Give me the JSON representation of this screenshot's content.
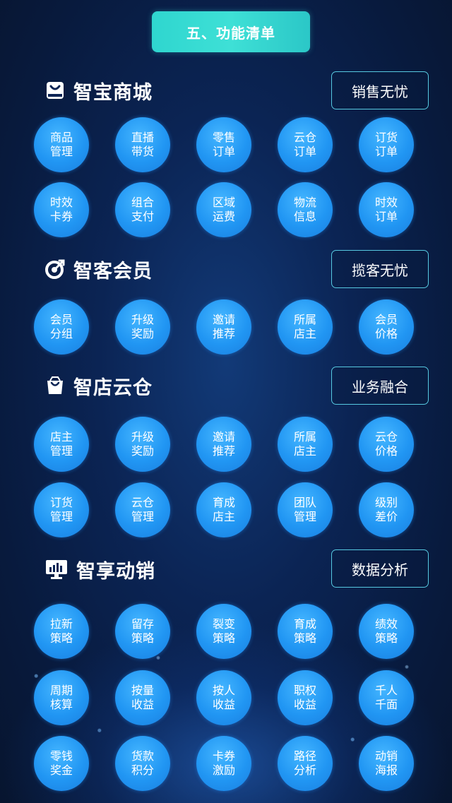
{
  "title": "五、功能清单",
  "sections": [
    {
      "name": "智宝商城",
      "tag": "销售无忧",
      "icon": "shopping-bag-icon",
      "rows": [
        [
          [
            "商品",
            "管理"
          ],
          [
            "直播",
            "带货"
          ],
          [
            "零售",
            "订单"
          ],
          [
            "云仓",
            "订单"
          ],
          [
            "订货",
            "订单"
          ]
        ],
        [
          [
            "时效",
            "卡券"
          ],
          [
            "组合",
            "支付"
          ],
          [
            "区域",
            "运费"
          ],
          [
            "物流",
            "信息"
          ],
          [
            "时效",
            "订单"
          ]
        ]
      ]
    },
    {
      "name": "智客会员",
      "tag": "揽客无忧",
      "icon": "target-arrow-icon",
      "rows": [
        [
          [
            "会员",
            "分组"
          ],
          [
            "升级",
            "奖励"
          ],
          [
            "邀请",
            "推荐"
          ],
          [
            "所属",
            "店主"
          ],
          [
            "会员",
            "价格"
          ]
        ]
      ]
    },
    {
      "name": "智店云仓",
      "tag": "业务融合",
      "icon": "store-bag-icon",
      "rows": [
        [
          [
            "店主",
            "管理"
          ],
          [
            "升级",
            "奖励"
          ],
          [
            "邀请",
            "推荐"
          ],
          [
            "所属",
            "店主"
          ],
          [
            "云仓",
            "价格"
          ]
        ],
        [
          [
            "订货",
            "管理"
          ],
          [
            "云仓",
            "管理"
          ],
          [
            "育成",
            "店主"
          ],
          [
            "团队",
            "管理"
          ],
          [
            "级别",
            "差价"
          ]
        ]
      ]
    },
    {
      "name": "智享动销",
      "tag": "数据分析",
      "icon": "monitor-chart-icon",
      "rows": [
        [
          [
            "拉新",
            "策略"
          ],
          [
            "留存",
            "策略"
          ],
          [
            "裂变",
            "策略"
          ],
          [
            "育成",
            "策略"
          ],
          [
            "绩效",
            "策略"
          ]
        ],
        [
          [
            "周期",
            "核算"
          ],
          [
            "按量",
            "收益"
          ],
          [
            "按人",
            "收益"
          ],
          [
            "职权",
            "收益"
          ],
          [
            "千人",
            "千面"
          ]
        ],
        [
          [
            "零钱",
            "奖金"
          ],
          [
            "货款",
            "积分"
          ],
          [
            "卡券",
            "激励"
          ],
          [
            "路径",
            "分析"
          ],
          [
            "动销",
            "海报"
          ]
        ]
      ]
    }
  ]
}
